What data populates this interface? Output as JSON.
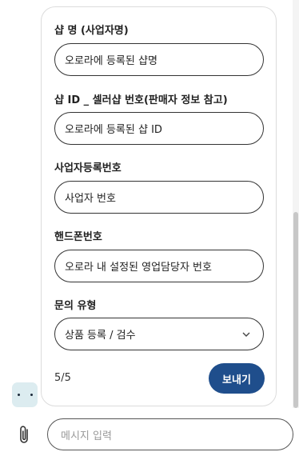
{
  "form": {
    "fields": [
      {
        "label": "샵 명 (사업자명)",
        "value": "오로라에 등록된 샵명"
      },
      {
        "label": "샵 ID _ 셀러샵 번호(판매자 정보 참고)",
        "value": "오로라에 등록된 샵 ID"
      },
      {
        "label": "사업자등록번호",
        "value": "사업자 번호"
      },
      {
        "label": "핸드폰번호",
        "value": "오로라 내 설정된 영업담당자 번호"
      }
    ],
    "inquiry_type": {
      "label": "문의 유형",
      "value": "상품 등록 / 검수"
    },
    "page_counter": "5/5",
    "send_label": "보내기"
  },
  "composer": {
    "placeholder": "메시지 입력",
    "attach_icon": "paperclip-icon"
  },
  "colors": {
    "accent": "#1f4e8c",
    "avatar_bg": "#dcecf0"
  }
}
